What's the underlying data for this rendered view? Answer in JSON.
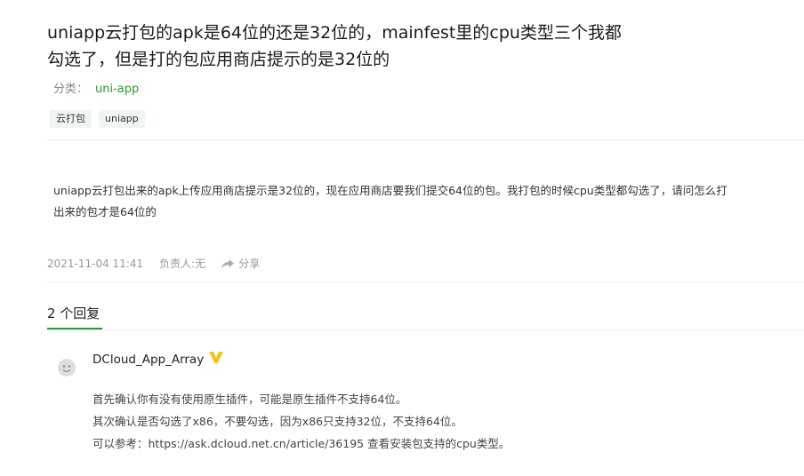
{
  "question": {
    "title_lines": [
      "uniapp云打包的apk是64位的还是32位的，mainfest里的cpu类型三个我都",
      "勾选了，但是打的包应用商店提示的是32位的"
    ],
    "category_label": "分类：",
    "category_value": "uni-app",
    "tags": [
      "云打包",
      "uniapp"
    ],
    "body_lines": [
      "uniapp云打包出来的apk上传应用商店提示是32位的，现在应用商店要我们提交64位的包。我打包的时候cpu类型都勾选了，请问怎么打",
      "出来的包才是64位的"
    ],
    "date": "2021-11-04 11:41",
    "owner": "负责人:无",
    "share_label": "分享"
  },
  "replies": {
    "count_label": "2 个回复",
    "items": [
      {
        "username": "DCloud_App_Array",
        "lines": [
          "首先确认你有没有使用原生插件，可能是原生插件不支持64位。",
          "其次确认是否勾选了x86，不要勾选，因为x86只支持32位，不支持64位。",
          "可以参考：https://ask.dcloud.net.cn/article/36195 查看安装包支持的cpu类型。"
        ]
      }
    ]
  },
  "colors": {
    "accent": "#2b9939",
    "badge": "#f2c511"
  },
  "icons": {
    "share": "share-icon",
    "avatar": "avatar-icon",
    "verified": "verified-badge-icon"
  }
}
